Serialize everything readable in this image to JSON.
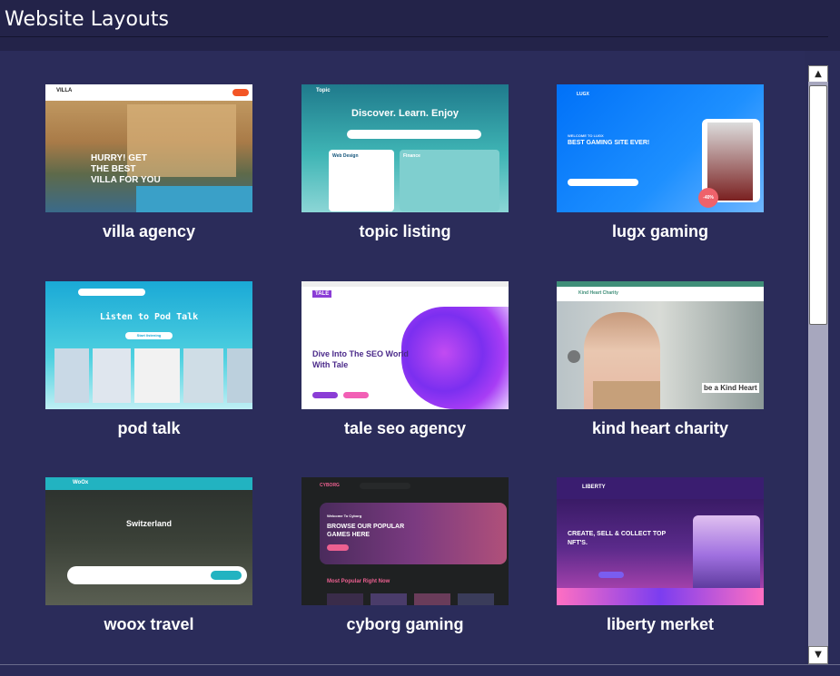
{
  "header": {
    "title": "Website Layouts"
  },
  "cards": [
    {
      "label": "villa agency",
      "thumb": {
        "brand": "VILLA",
        "headline": "HURRY! GET THE BEST VILLA FOR YOU"
      }
    },
    {
      "label": "topic listing",
      "thumb": {
        "brand": "Topic",
        "headline": "Discover. Learn. Enjoy",
        "card1": "Web Design",
        "card2": "Finance"
      }
    },
    {
      "label": "lugx gaming",
      "thumb": {
        "brand": "LUGX",
        "welcome": "WELCOME TO LUGX",
        "headline": "BEST GAMING SITE EVER!",
        "badge": "-40%"
      }
    },
    {
      "label": "pod talk",
      "thumb": {
        "headline": "Listen to Pod Talk",
        "button": "Start listening"
      }
    },
    {
      "label": "tale seo agency",
      "thumb": {
        "brand": "TALE",
        "headline": "Dive Into The SEO World With Tale"
      }
    },
    {
      "label": "kind heart charity",
      "thumb": {
        "brand": "Kind Heart Charity",
        "headline": "be a Kind Heart"
      }
    },
    {
      "label": "woox travel",
      "thumb": {
        "brand": "WoOx",
        "headline": "Switzerland"
      }
    },
    {
      "label": "cyborg gaming",
      "thumb": {
        "brand": "CYBORG",
        "welcome": "Welcome To Cyborg",
        "headline": "BROWSE OUR POPULAR GAMES HERE",
        "section": "Most Popular Right Now"
      }
    },
    {
      "label": "liberty merket",
      "thumb": {
        "brand": "LIBERTY",
        "headline": "CREATE, SELL & COLLECT TOP NFT'S."
      }
    }
  ],
  "scrollbar": {
    "up_icon": "triangle-up",
    "down_icon": "triangle-down"
  }
}
